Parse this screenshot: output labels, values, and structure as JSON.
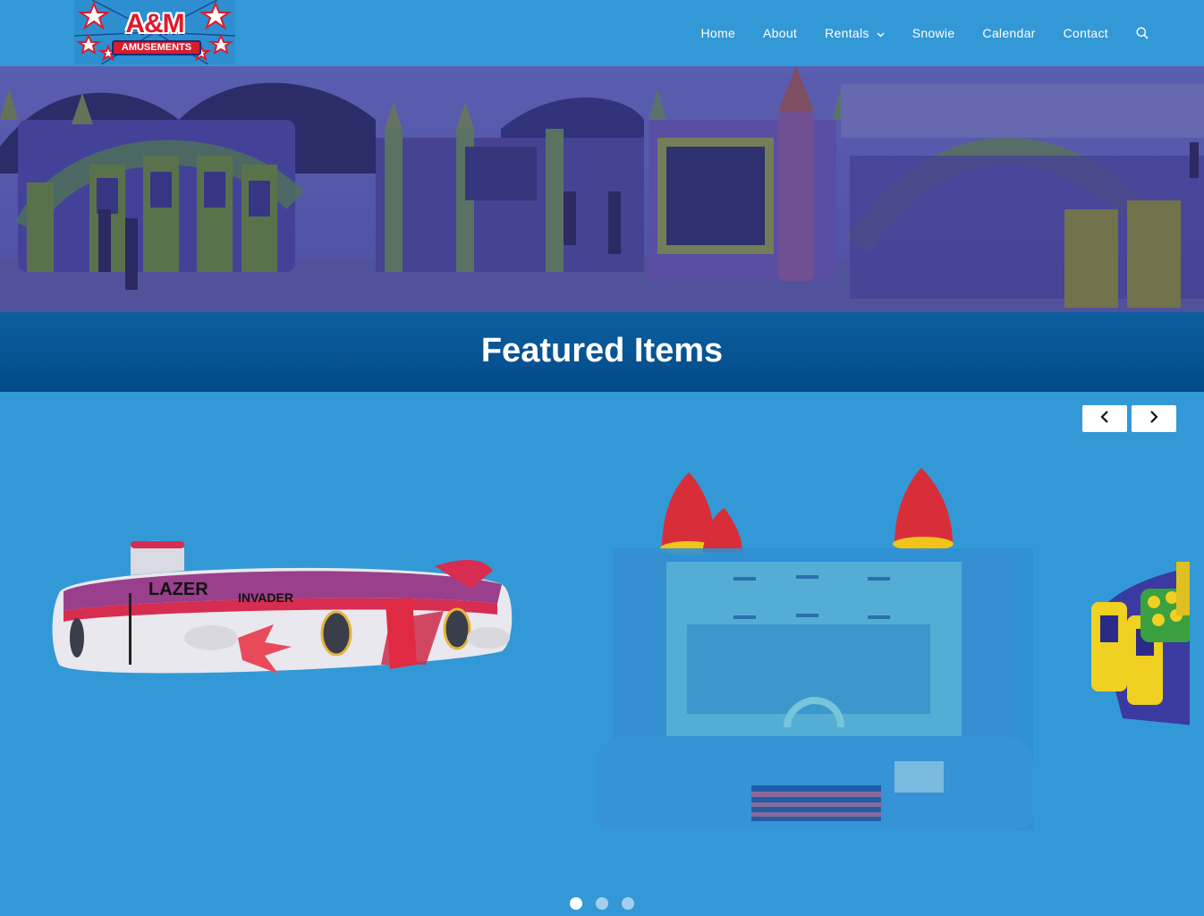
{
  "brand": {
    "logo_main": "A&M",
    "logo_sub": "AMUSEMENTS"
  },
  "nav": {
    "items": [
      {
        "label": "Home"
      },
      {
        "label": "About"
      },
      {
        "label": "Rentals",
        "has_dropdown": true
      },
      {
        "label": "Snowie"
      },
      {
        "label": "Calendar"
      },
      {
        "label": "Contact"
      }
    ],
    "search_icon": "search-icon"
  },
  "featured": {
    "title": "Featured Items"
  },
  "carousel": {
    "prev_icon": "chevron-left-icon",
    "next_icon": "chevron-right-icon",
    "slides": [
      {
        "image": "lazer-invader-inflatable"
      },
      {
        "image": "castle-bounce-house"
      },
      {
        "image": "obstacle-course-inflatable"
      }
    ],
    "dots": 3,
    "active_dot": 0
  },
  "colors": {
    "header_bg": "#3399d6",
    "featured_bar": "#034a8a",
    "accent_white": "#ffffff"
  }
}
